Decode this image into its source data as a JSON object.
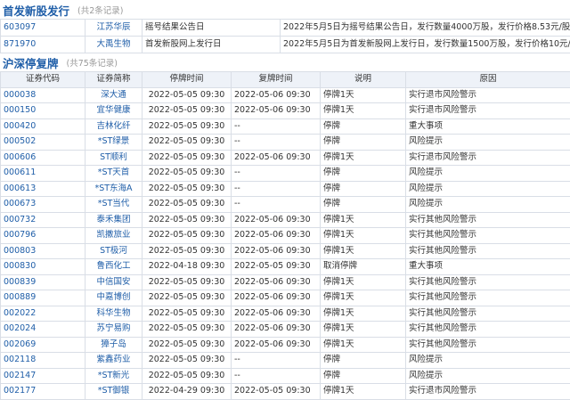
{
  "ipo": {
    "title": "首发新股发行",
    "count": "(共2条记录)",
    "rows": [
      {
        "code": "603097",
        "name": "江苏华辰",
        "type": "摇号结果公告日",
        "desc": "2022年5月5日为摇号结果公告日，发行数量4000万股，发行价格8.53元/股"
      },
      {
        "code": "871970",
        "name": "大禹生物",
        "type": "首发新股网上发行日",
        "desc": "2022年5月5日为首发新股网上发行日，发行数量1500万股，发行价格10元/股"
      }
    ]
  },
  "suspend": {
    "title": "沪深停复牌",
    "count": "(共75条记录)",
    "headers": [
      "证券代码",
      "证券简称",
      "停牌时间",
      "复牌时间",
      "说明",
      "原因"
    ],
    "rows": [
      [
        "000038",
        "深大通",
        "2022-05-05 09:30",
        "2022-05-06 09:30",
        "停牌1天",
        "实行退市风险警示"
      ],
      [
        "000150",
        "宜华健康",
        "2022-05-05 09:30",
        "2022-05-06 09:30",
        "停牌1天",
        "实行退市风险警示"
      ],
      [
        "000420",
        "吉林化纤",
        "2022-05-05 09:30",
        "--",
        "停牌",
        "重大事项"
      ],
      [
        "000502",
        "*ST绿景",
        "2022-05-05 09:30",
        "--",
        "停牌",
        "风险提示"
      ],
      [
        "000606",
        "ST顺利",
        "2022-05-05 09:30",
        "2022-05-06 09:30",
        "停牌1天",
        "实行退市风险警示"
      ],
      [
        "000611",
        "*ST天首",
        "2022-05-05 09:30",
        "--",
        "停牌",
        "风险提示"
      ],
      [
        "000613",
        "*ST东海A",
        "2022-05-05 09:30",
        "--",
        "停牌",
        "风险提示"
      ],
      [
        "000673",
        "*ST当代",
        "2022-05-05 09:30",
        "--",
        "停牌",
        "风险提示"
      ],
      [
        "000732",
        "泰禾集团",
        "2022-05-05 09:30",
        "2022-05-06 09:30",
        "停牌1天",
        "实行其他风险警示"
      ],
      [
        "000796",
        "凯撒旅业",
        "2022-05-05 09:30",
        "2022-05-06 09:30",
        "停牌1天",
        "实行其他风险警示"
      ],
      [
        "000803",
        "ST极河",
        "2022-05-05 09:30",
        "2022-05-06 09:30",
        "停牌1天",
        "实行其他风险警示"
      ],
      [
        "000830",
        "鲁西化工",
        "2022-04-18 09:30",
        "2022-05-05 09:30",
        "取消停牌",
        "重大事项"
      ],
      [
        "000839",
        "中信国安",
        "2022-05-05 09:30",
        "2022-05-06 09:30",
        "停牌1天",
        "实行其他风险警示"
      ],
      [
        "000889",
        "中嘉博创",
        "2022-05-05 09:30",
        "2022-05-06 09:30",
        "停牌1天",
        "实行其他风险警示"
      ],
      [
        "002022",
        "科华生物",
        "2022-05-05 09:30",
        "2022-05-06 09:30",
        "停牌1天",
        "实行其他风险警示"
      ],
      [
        "002024",
        "苏宁易购",
        "2022-05-05 09:30",
        "2022-05-06 09:30",
        "停牌1天",
        "实行其他风险警示"
      ],
      [
        "002069",
        "獐子岛",
        "2022-05-05 09:30",
        "2022-05-06 09:30",
        "停牌1天",
        "实行其他风险警示"
      ],
      [
        "002118",
        "紫鑫药业",
        "2022-05-05 09:30",
        "--",
        "停牌",
        "风险提示"
      ],
      [
        "002147",
        "*ST新光",
        "2022-05-05 09:30",
        "--",
        "停牌",
        "风险提示"
      ],
      [
        "002177",
        "*ST御银",
        "2022-04-29 09:30",
        "2022-05-05 09:30",
        "停牌1天",
        "实行退市风险警示"
      ]
    ]
  }
}
